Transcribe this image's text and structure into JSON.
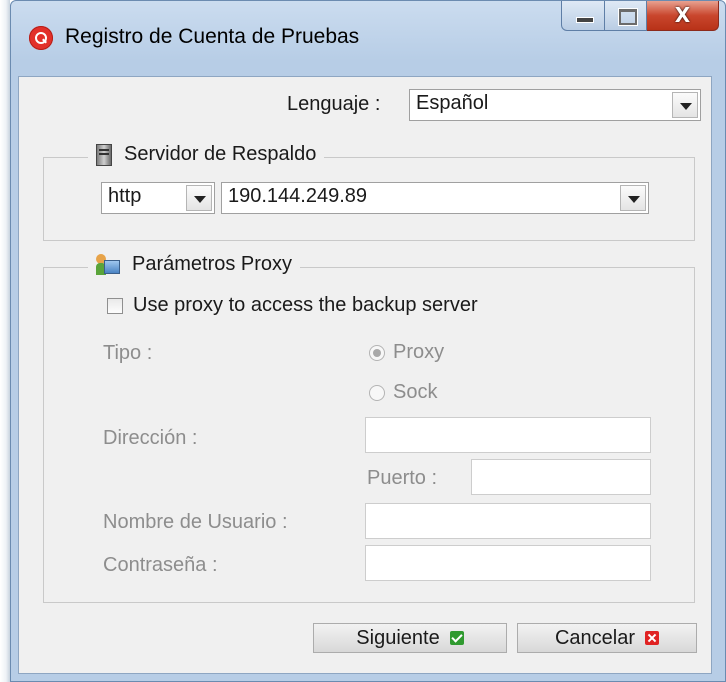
{
  "window": {
    "title": "Registro de Cuenta de Pruebas",
    "controls": {
      "minimize": "minimize-icon",
      "maximize": "maximize-icon",
      "close": "X"
    }
  },
  "language": {
    "label": "Lenguaje :",
    "value": "Español"
  },
  "backup_server": {
    "legend": "Servidor de Respaldo",
    "icon": "server-icon",
    "protocol": "http",
    "address": "190.144.249.89"
  },
  "proxy": {
    "legend": "Parámetros Proxy",
    "icon": "proxy-settings-icon",
    "use_proxy_label": "Use proxy to access the backup server",
    "use_proxy_checked": false,
    "type_label": "Tipo :",
    "type_options": [
      "Proxy",
      "Sock"
    ],
    "type_selected": "Proxy",
    "address_label": "Dirección :",
    "address_value": "",
    "port_label": "Puerto :",
    "port_value": "",
    "username_label": "Nombre de Usuario :",
    "username_value": "",
    "password_label": "Contraseña :",
    "password_value": ""
  },
  "buttons": {
    "next": "Siguiente",
    "cancel": "Cancelar"
  },
  "colors": {
    "ok": "#2f9a2f",
    "cancel": "#e02222",
    "disabled_text": "#8d8d8d",
    "app_icon": "#e2302a"
  }
}
